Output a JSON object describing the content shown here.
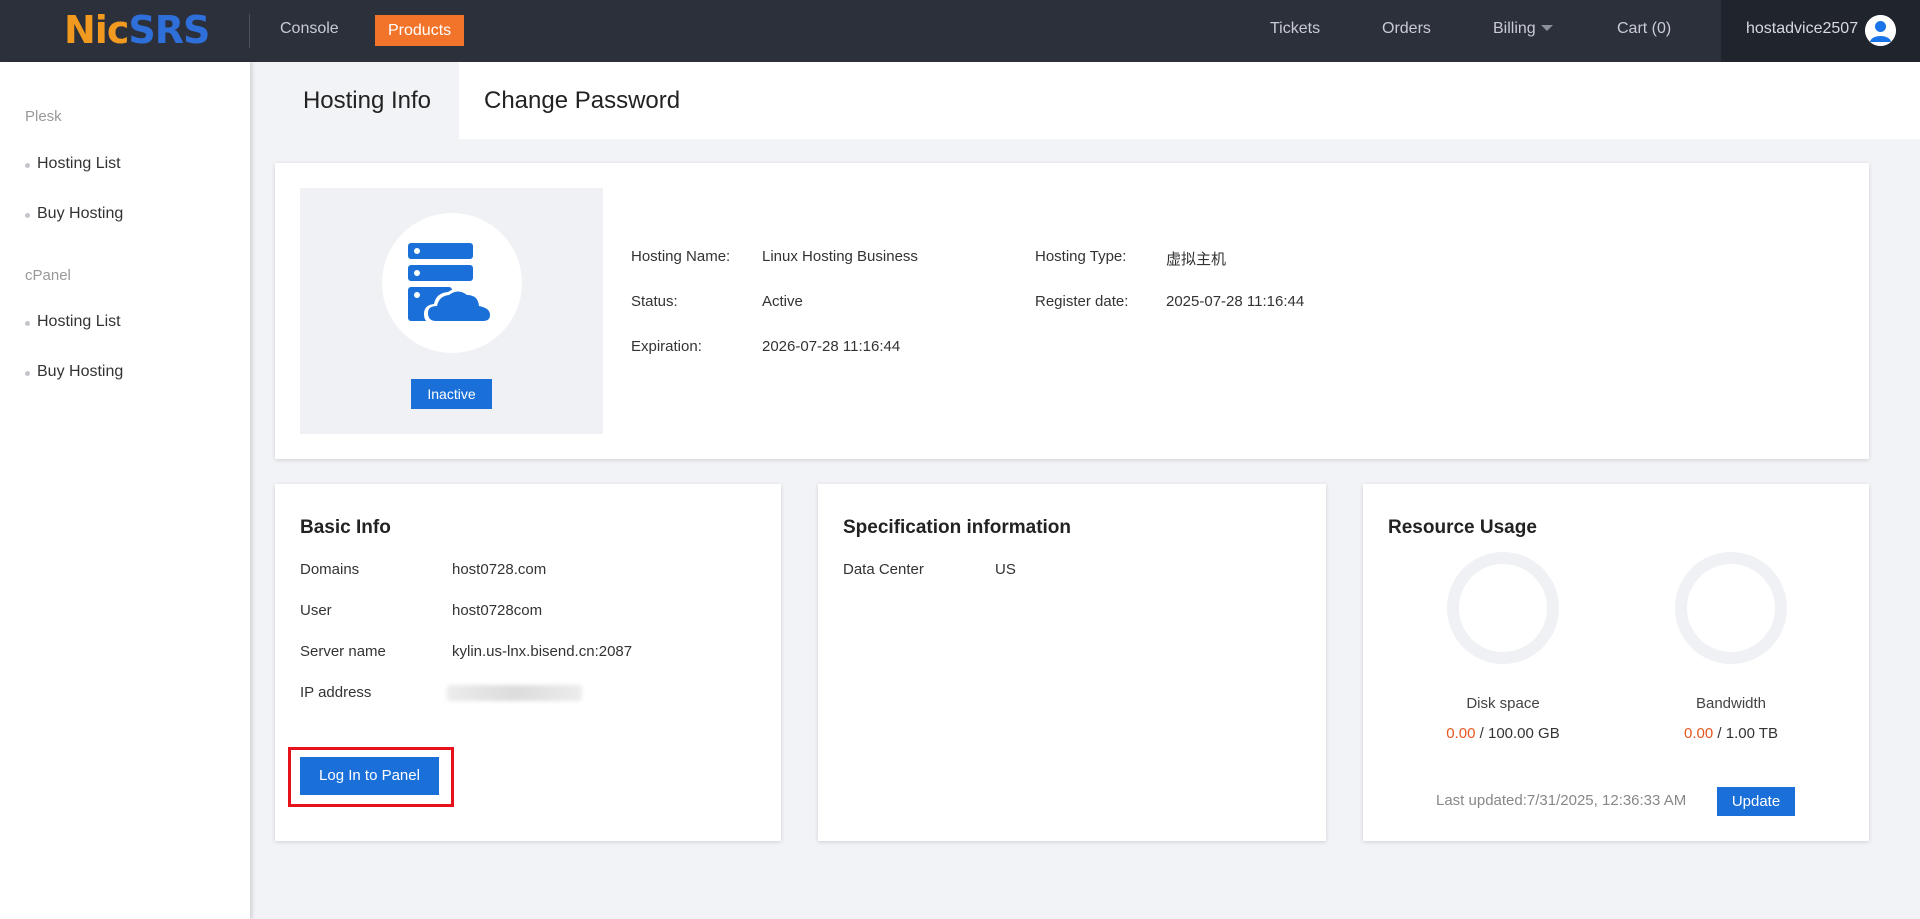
{
  "brand": {
    "logo_part1": "Nic",
    "logo_part2": "SRS"
  },
  "topnav": {
    "console": "Console",
    "products": "Products",
    "tickets": "Tickets",
    "orders": "Orders",
    "billing": "Billing",
    "cart": "Cart (0)",
    "username": "hostadvice2507"
  },
  "sidebar": {
    "groups": [
      {
        "title": "Plesk",
        "items": [
          "Hosting List",
          "Buy Hosting"
        ]
      },
      {
        "title": "cPanel",
        "items": [
          "Hosting List",
          "Buy Hosting"
        ]
      }
    ]
  },
  "tabs": [
    "Hosting Info",
    "Change Password"
  ],
  "hosting": {
    "status_button": "Inactive",
    "fields": [
      {
        "label": "Hosting Name:",
        "value": "Linux Hosting Business"
      },
      {
        "label": "Hosting Type:",
        "value": "虚拟主机"
      },
      {
        "label": "Status:",
        "value": "Active"
      },
      {
        "label": "Register date:",
        "value": "2025-07-28 11:16:44"
      },
      {
        "label": "Expiration:",
        "value": "2026-07-28 11:16:44"
      }
    ]
  },
  "basic_info": {
    "title": "Basic Info",
    "rows": [
      {
        "label": "Domains",
        "value": "host0728.com"
      },
      {
        "label": "User",
        "value": "host0728com"
      },
      {
        "label": "Server name",
        "value": "kylin.us-lnx.bisend.cn:2087"
      },
      {
        "label": "IP address",
        "value": ""
      }
    ],
    "login_button": "Log In to Panel"
  },
  "spec_info": {
    "title": "Specification information",
    "rows": [
      {
        "label": "Data Center",
        "value": "US"
      }
    ]
  },
  "resource_usage": {
    "title": "Resource Usage",
    "disk": {
      "label": "Disk space",
      "used": "0.00",
      "total": " / 100.00 GB",
      "fraction": 0
    },
    "bandwidth": {
      "label": "Bandwidth",
      "used": "0.00",
      "total": " / 1.00 TB",
      "fraction": 0
    },
    "last_updated": "Last updated:7/31/2025, 12:36:33 AM",
    "update_button": "Update"
  },
  "colors": {
    "topbar": "#2b303b",
    "accent_orange": "#f2742b",
    "primary_blue": "#1a6fd8",
    "highlight_red": "#e6121b",
    "usage_orange": "#e4571f"
  }
}
